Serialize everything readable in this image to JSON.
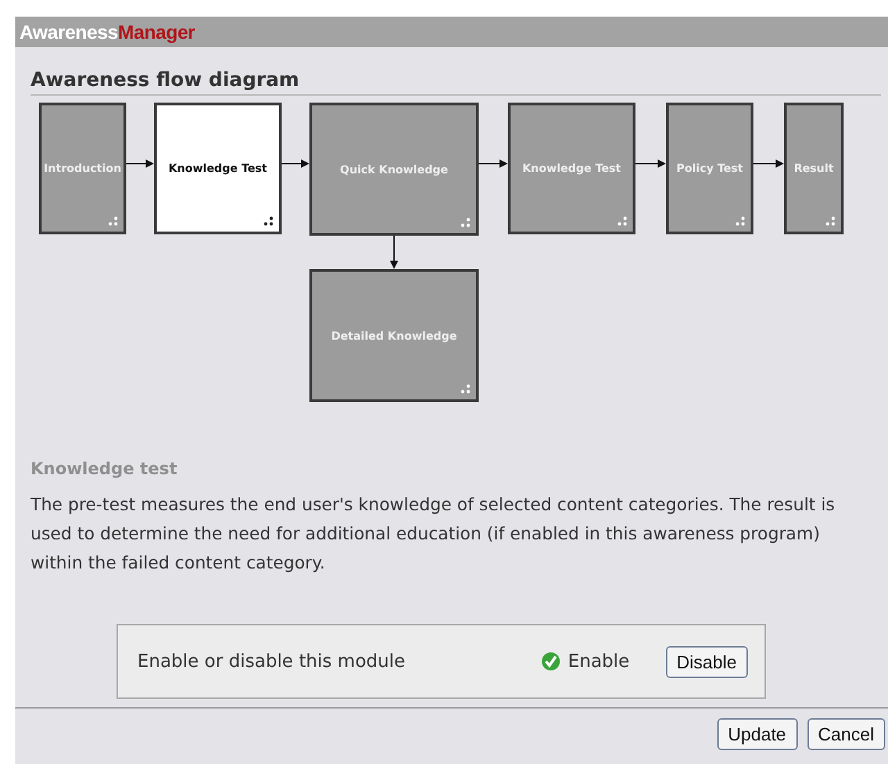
{
  "window": {
    "title_part_1": "Awareness",
    "title_part_2": "Manager"
  },
  "diagram": {
    "heading": "Awareness flow diagram",
    "nodes": [
      {
        "label": "Introduction",
        "selected": false
      },
      {
        "label": "Knowledge Test",
        "selected": true
      },
      {
        "label": "Quick Knowledge",
        "selected": false
      },
      {
        "label": "Knowledge Test",
        "selected": false
      },
      {
        "label": "Policy Test",
        "selected": false
      },
      {
        "label": "Result",
        "selected": false
      },
      {
        "label": "Detailed Knowledge",
        "selected": false
      }
    ]
  },
  "detail": {
    "title": "Knowledge test",
    "description": "The pre-test measures the end user's knowledge of selected content categories. The result is used to determine the need for additional education (if enabled in this awareness program) within the failed content category."
  },
  "module": {
    "label": "Enable or disable this module",
    "enabled": true,
    "status": "Enable",
    "toggle_button": "Disable"
  },
  "buttons": [
    "Update",
    "Cancel"
  ]
}
